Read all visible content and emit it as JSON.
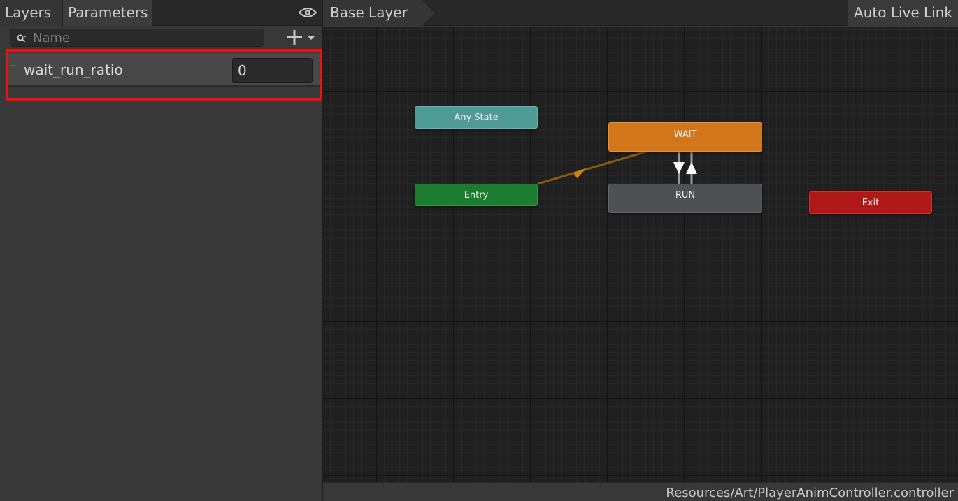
{
  "left_panel": {
    "tabs": [
      {
        "label": "Layers",
        "active": false
      },
      {
        "label": "Parameters",
        "active": true
      }
    ],
    "visibility_icon": "eye-icon",
    "search": {
      "placeholder": "Name",
      "value": "",
      "icon": "search-icon"
    },
    "add_button_icon": "plus-dropdown-icon",
    "parameters": [
      {
        "name": "wait_run_ratio",
        "type": "float",
        "value": "0"
      }
    ]
  },
  "graph_toolbar": {
    "breadcrumb": "Base Layer",
    "auto_live_link_label": "Auto Live Link"
  },
  "graph": {
    "nodes": {
      "any_state": "Any State",
      "entry": "Entry",
      "wait": "WAIT",
      "run": "RUN",
      "exit": "Exit"
    },
    "colors": {
      "any_state": "#4e9a94",
      "entry": "#1b7b2e",
      "default_state": "#d1761a",
      "state": "#4e5053",
      "exit": "#b01818",
      "highlight": "#ee1111"
    }
  },
  "status_bar": {
    "path": "Resources/Art/PlayerAnimController.controller"
  }
}
